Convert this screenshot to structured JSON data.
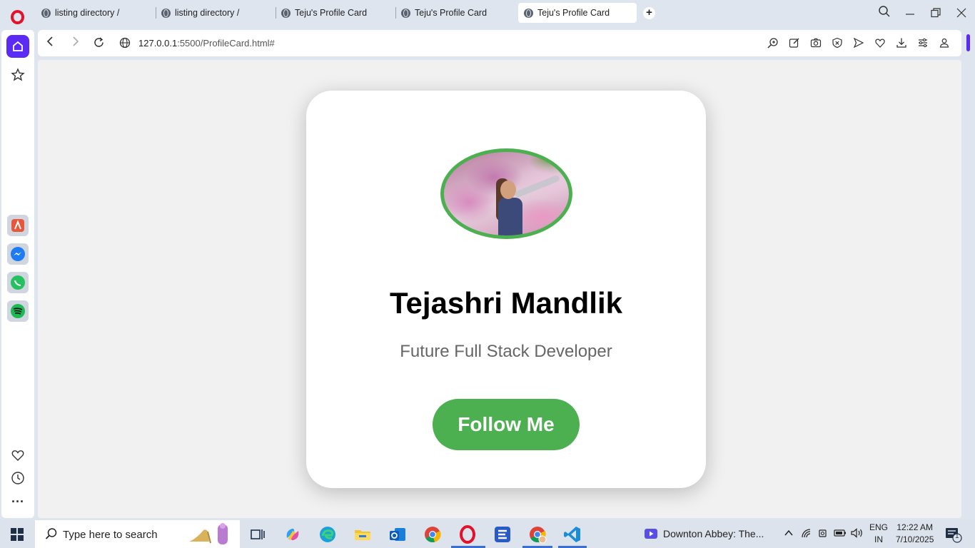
{
  "browser": {
    "tabs": [
      {
        "title": "listing directory /",
        "active": false
      },
      {
        "title": "listing directory /",
        "active": false
      },
      {
        "title": "Teju's Profile Card",
        "active": false
      },
      {
        "title": "Teju's Profile Card",
        "active": false
      },
      {
        "title": "Teju's Profile Card",
        "active": true
      }
    ],
    "url_host": "127.0.0.1",
    "url_rest": ":5500/ProfileCard.html#"
  },
  "sidebar": {
    "items": [
      "home-icon",
      "bookmarks-star-icon",
      "aria-icon",
      "messenger-icon",
      "whatsapp-icon",
      "spotify-icon",
      "pinboard-heart-icon",
      "history-clock-icon",
      "more-icon"
    ]
  },
  "profile": {
    "name": "Tejashri Mandlik",
    "role": "Future Full Stack Developer",
    "button": "Follow Me",
    "accent": "#4caf50"
  },
  "taskbar": {
    "search_placeholder": "Type here to search",
    "media_title": "Downton Abbey: The...",
    "lang_top": "ENG",
    "lang_bottom": "IN",
    "time": "12:22 AM",
    "date": "7/10/2025",
    "notification_count": "1"
  }
}
